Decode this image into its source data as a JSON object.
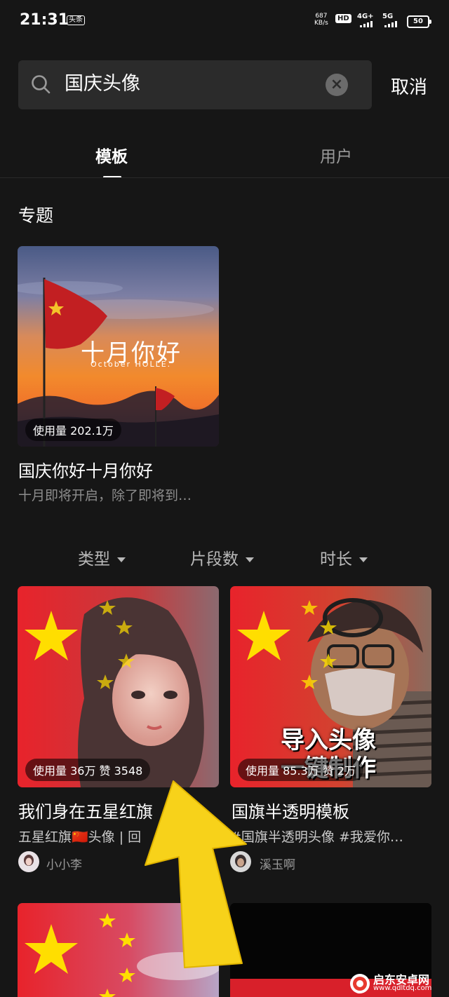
{
  "status_bar": {
    "time": "21:31",
    "app_badge": "头条",
    "net_speed_value": "687",
    "net_speed_unit": "KB/s",
    "hd_label": "HD",
    "signal1_label": "4G+",
    "signal2_label": "5G",
    "battery": "50"
  },
  "search": {
    "query": "国庆头像",
    "cancel_label": "取消"
  },
  "tabs": [
    {
      "label": "模板",
      "active": true
    },
    {
      "label": "用户",
      "active": false
    }
  ],
  "topic_section": {
    "title": "专题",
    "card": {
      "overlay_title": "十月你好",
      "overlay_subtitle": "October HOLLE.",
      "usage": "使用量 202.1万",
      "title": "国庆你好十月你好",
      "subtitle": "十月即将开启，除了即将到…"
    }
  },
  "filters": [
    {
      "label": "类型"
    },
    {
      "label": "片段数"
    },
    {
      "label": "时长"
    }
  ],
  "templates": [
    {
      "usage": "使用量 36万 赞 3548",
      "title": "我们身在五星红旗",
      "tags": "五星红旗🇨🇳头像 | 回",
      "author": "小小李"
    },
    {
      "overlay_line1": "导入头像",
      "overlay_line2": "一键制作",
      "usage": "使用量 85.3万 赞 2万",
      "title": "国旗半透明模板",
      "tags": "#国旗半透明头像 #我爱你…",
      "author": "溪玉啊"
    }
  ],
  "watermark": {
    "name": "启东安卓网",
    "url": "www.qdltdq.com"
  },
  "colors": {
    "background": "#161616",
    "flag_red": "#e8232b",
    "star_yellow": "#ffde00",
    "arrow_yellow": "#f7d21a"
  }
}
